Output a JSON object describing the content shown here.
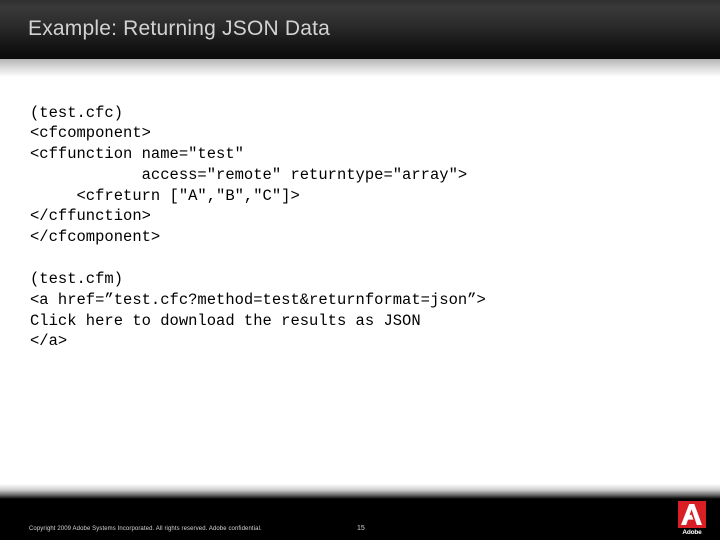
{
  "slide": {
    "title": "Example: Returning JSON Data",
    "title_color": "#d2d2d2",
    "header_bg": "#1a1a1a",
    "body_bg": "#ffffff"
  },
  "code_blocks": [
    {
      "name": "cfc-example",
      "text": "(test.cfc)\n<cfcomponent>\n<cffunction name=\"test\"\n            access=\"remote\" returntype=\"array\">\n     <cfreturn [\"A\",\"B\",\"C\"]>\n</cffunction>\n</cfcomponent>"
    },
    {
      "name": "cfm-example",
      "text": "(test.cfm)\n<a href=”test.cfc?method=test&returnformat=json”>\nClick here to download the results as JSON\n</a>"
    }
  ],
  "footer": {
    "copyright": "Copyright 2009 Adobe Systems Incorporated. All rights reserved. Adobe confidential.",
    "page_number": "15",
    "text_color": "#d6d6d6",
    "background": "#000000"
  },
  "logo": {
    "name": "adobe-logo",
    "wordmark": "Adobe",
    "mark_color": "#d81f26",
    "glyph_color": "#ffffff"
  }
}
